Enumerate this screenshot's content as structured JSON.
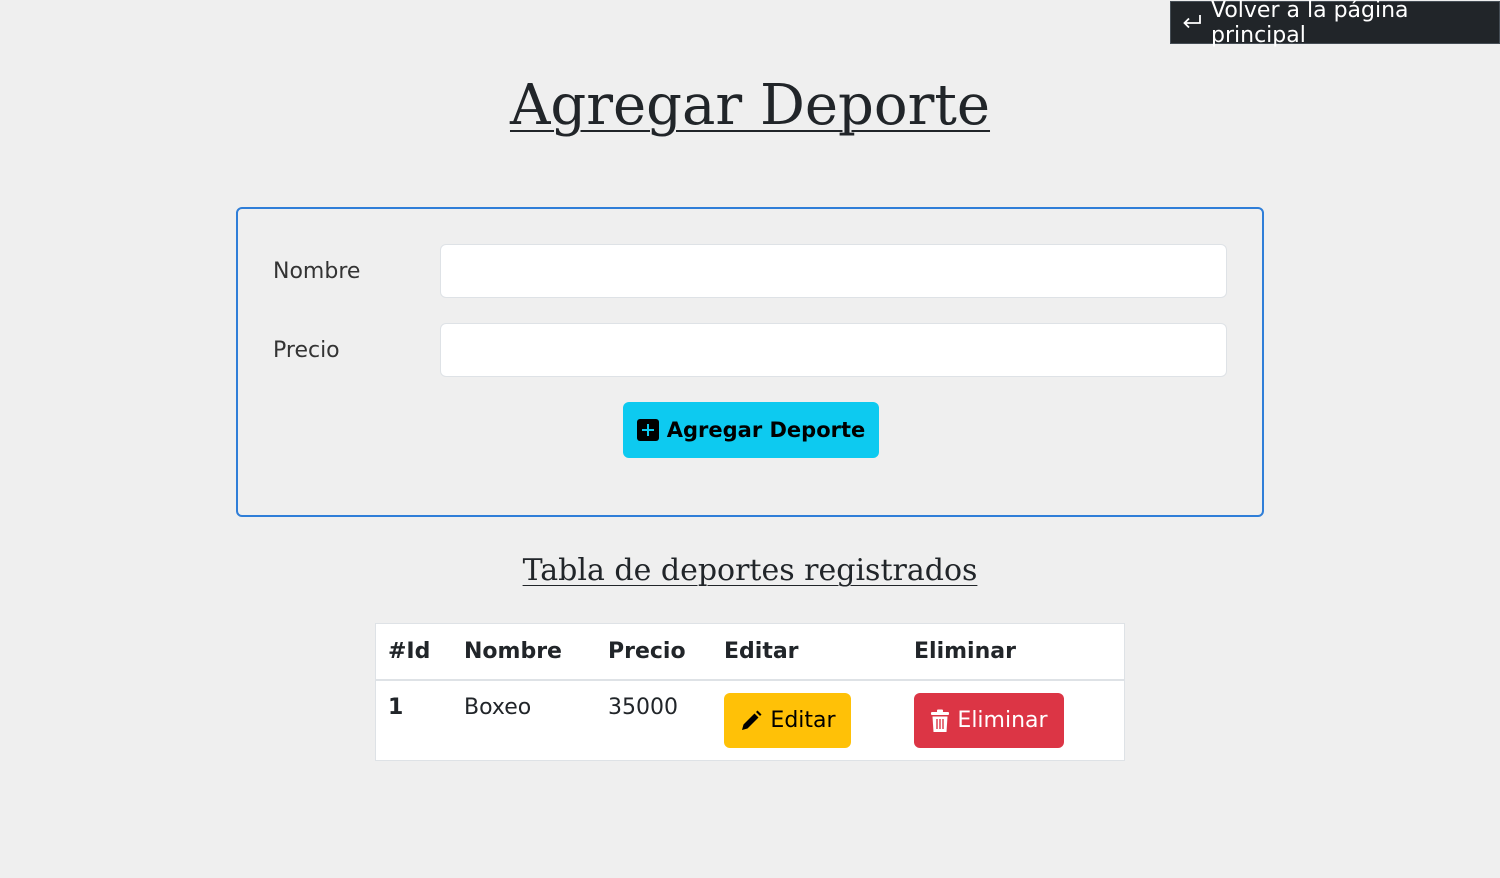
{
  "nav": {
    "back_label": "Volver a la página principal",
    "back_icon": "return-arrow-icon"
  },
  "header": {
    "title": "Agregar Deporte"
  },
  "form": {
    "nombre_label": "Nombre",
    "nombre_value": "",
    "precio_label": "Precio",
    "precio_value": "",
    "submit_label": "Agregar Deporte",
    "submit_icon": "plus-square-icon"
  },
  "table": {
    "title": "Tabla de deportes registrados",
    "columns": [
      "#Id",
      "Nombre",
      "Precio",
      "Editar",
      "Eliminar"
    ],
    "rows": [
      {
        "id": "1",
        "nombre": "Boxeo",
        "precio": "35000",
        "edit_label": "Editar",
        "edit_icon": "pencil-icon",
        "delete_label": "Eliminar",
        "delete_icon": "trash-icon"
      }
    ]
  },
  "colors": {
    "background": "#efefef",
    "back_link_bg": "#212529",
    "form_border": "#2f7ed8",
    "add_button": "#0dcaf0",
    "edit_button": "#ffc107",
    "delete_button": "#dc3545"
  }
}
